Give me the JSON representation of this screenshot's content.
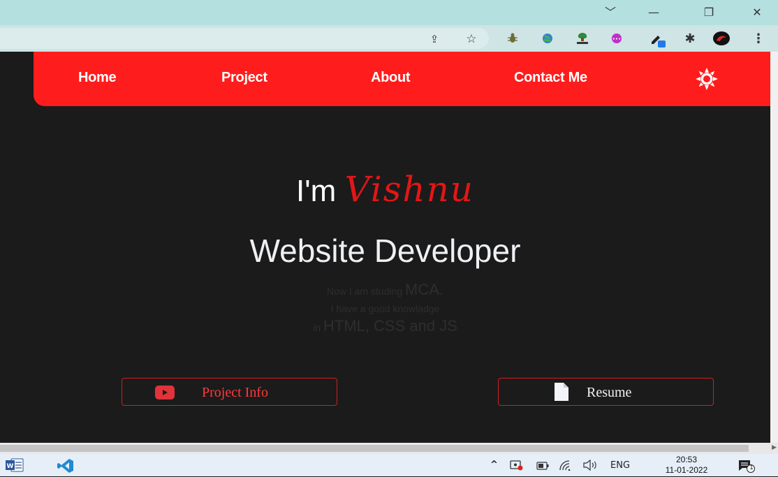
{
  "window": {
    "controls": {
      "tabs_menu": "﹀",
      "minimize": "—",
      "restore": "❐",
      "close": "✕"
    }
  },
  "toolbar": {
    "icons": [
      "share-icon",
      "bookmark-star-icon",
      "bug-extension-icon",
      "globe-extension-icon",
      "html-extension-icon",
      "purple-extension-icon",
      "eyedropper-extension-icon",
      "puzzle-extensions-icon",
      "profile-avatar-icon",
      "menu-kebab-icon"
    ],
    "glyphs": {
      "share": "⇪",
      "star": "☆",
      "menu": "⋮",
      "puzzle": "✱"
    }
  },
  "nav": {
    "items": [
      {
        "label": "Home"
      },
      {
        "label": "Project"
      },
      {
        "label": "About"
      },
      {
        "label": "Contact Me"
      }
    ],
    "theme_toggle_icon": "sun-icon"
  },
  "hero": {
    "intro": "I'm",
    "name": "Vishnu",
    "role": "Website Developer",
    "description": {
      "line1_prefix": "Now I am studing",
      "line1_emphasis": "MCA.",
      "line2": "I have a good knowladge",
      "line3_prefix": "in",
      "line3_emphasis": "HTML, CSS and JS"
    }
  },
  "buttons": {
    "project_info": "Project Info",
    "resume": "Resume"
  },
  "colors": {
    "accent": "#ff1c1c",
    "name_script": "#e31616",
    "background": "#1b1b1b",
    "button_border": "#d01f1f"
  },
  "taskbar": {
    "apps": [
      "word-icon",
      "vscode-icon"
    ],
    "tray": {
      "chevron": "^",
      "language": "ENG",
      "time": "20:53",
      "date": "11-01-2022",
      "notification_count": "1"
    }
  }
}
